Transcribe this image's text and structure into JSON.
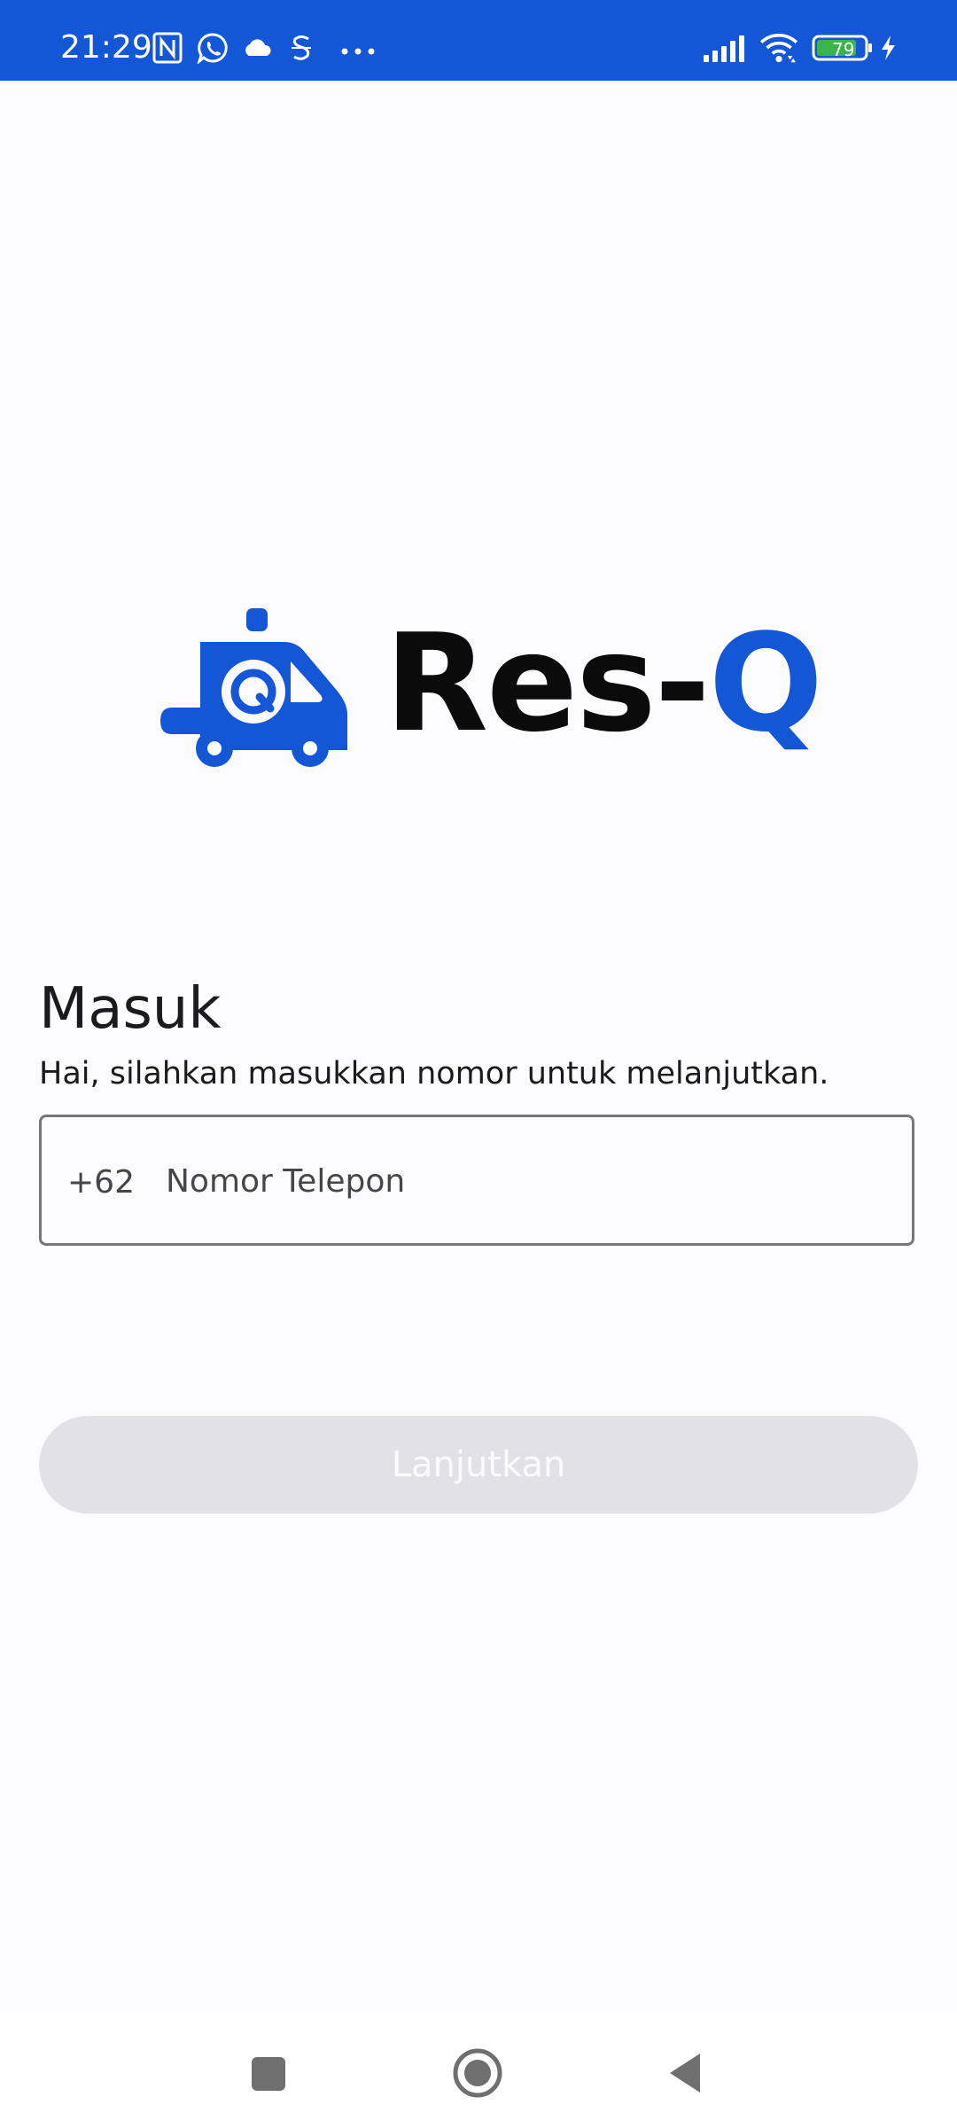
{
  "status_bar": {
    "time": "21:29",
    "background_color": "#1356d6",
    "left_icons": [
      "nfc-icon",
      "whatsapp-icon",
      "cloud-icon",
      "s-app-icon",
      "more-dots-icon"
    ],
    "right_icons": [
      "signal-icon",
      "wifi-icon",
      "battery-icon",
      "charging-icon"
    ],
    "battery_level": "79"
  },
  "logo": {
    "wordmark_main": "Res-",
    "wordmark_accent": "Q",
    "badge_letter": "Q",
    "brand_color": "#1356d6"
  },
  "login": {
    "title": "Masuk",
    "subtitle": "Hai, silahkan masukkan nomor untuk melanjutkan.",
    "phone": {
      "prefix": "+62",
      "placeholder": "Nomor Telepon",
      "value": ""
    },
    "continue_label": "Lanjutkan"
  },
  "nav_bar": {
    "buttons": [
      "recents-icon",
      "home-icon",
      "back-icon"
    ]
  }
}
